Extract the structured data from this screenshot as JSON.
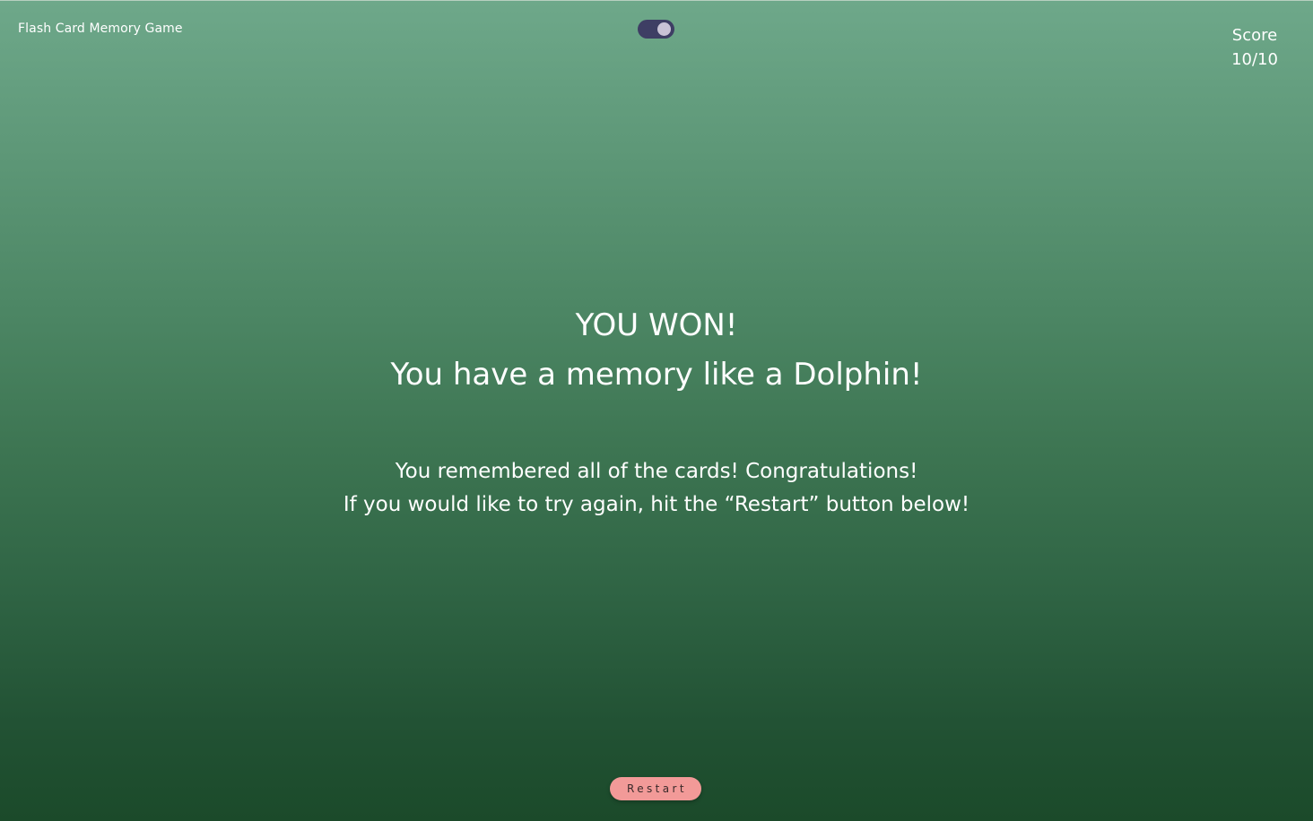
{
  "header": {
    "app_title": "Flash Card Memory Game",
    "theme_toggle": {
      "on": true,
      "track_color": "#3e3e64",
      "knob_color": "#c9c3d6"
    },
    "score_label": "Score",
    "score_value": "10/10"
  },
  "result": {
    "headline": "YOU WON!",
    "subheadline": "You have a memory like a Dolphin!",
    "message_line1": "You remembered all of the cards! Congratulations!",
    "message_line2": "If you would like to try again, hit the “Restart” button below!"
  },
  "actions": {
    "restart_label": "Restart",
    "restart_color": "#f29a98"
  },
  "theme": {
    "background_top": "#6ea88a",
    "background_bottom": "#1b4a2a",
    "text_color": "#ffffff"
  }
}
